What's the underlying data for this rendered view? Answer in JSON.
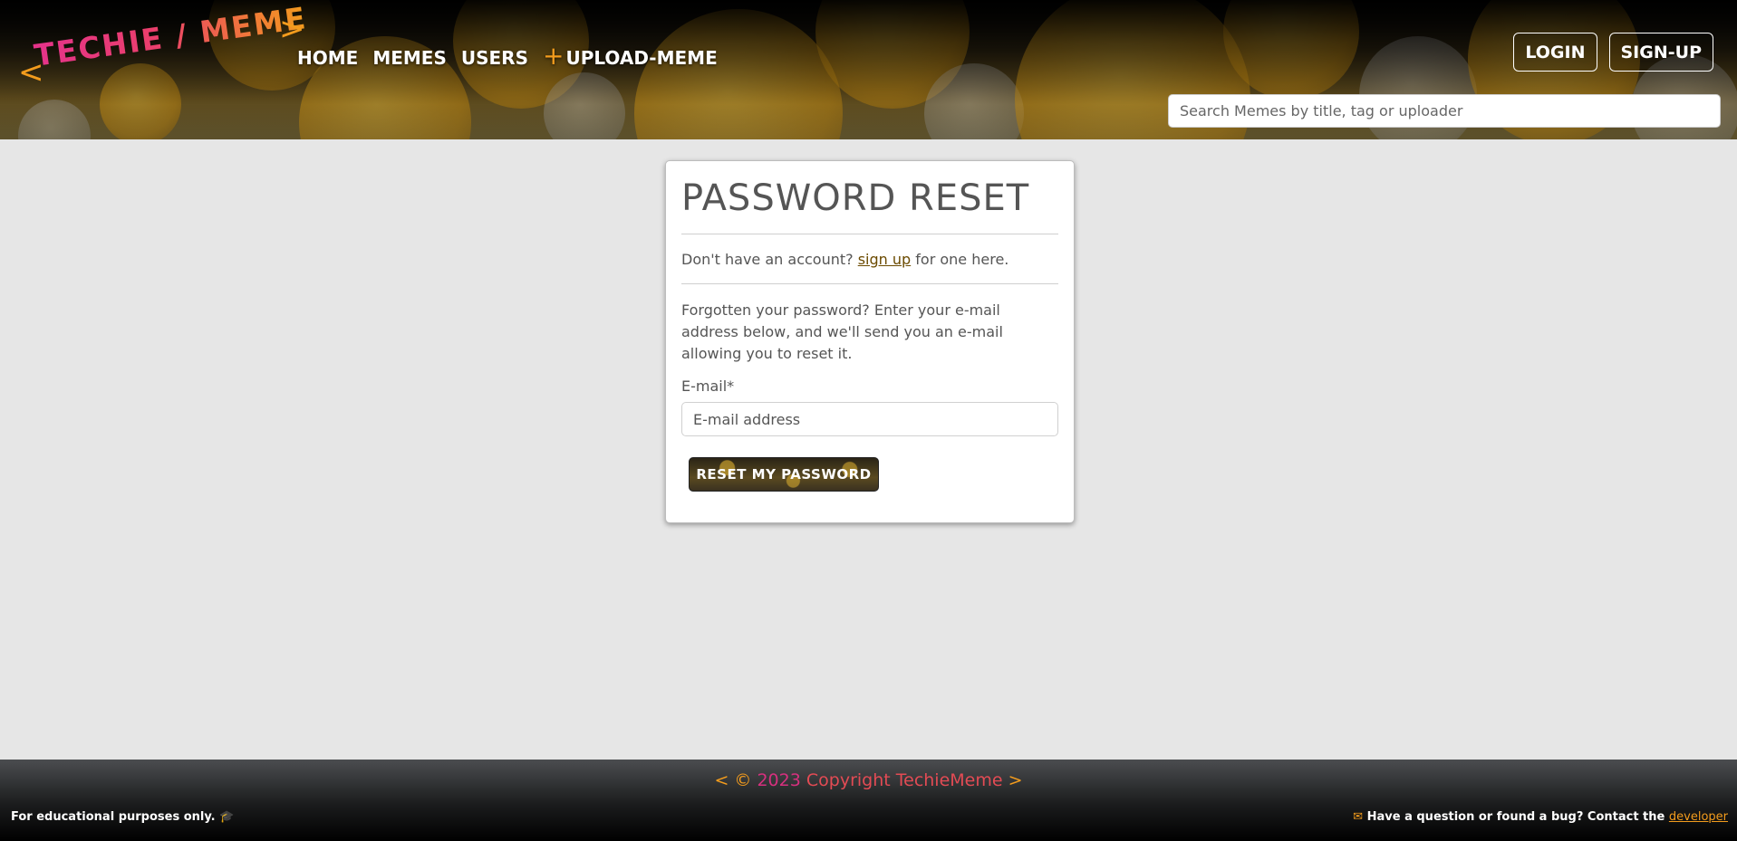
{
  "header": {
    "brand": {
      "open": "<",
      "text": "TECHIE / MEME",
      "close": ">"
    },
    "nav": [
      {
        "label": "HOME"
      },
      {
        "label": "MEMES"
      },
      {
        "label": "USERS"
      },
      {
        "label": "UPLOAD-MEME",
        "prefix": "+"
      }
    ],
    "auth": {
      "login": "LOGIN",
      "signup": "SIGN-UP"
    },
    "search": {
      "placeholder": "Search Memes by title, tag or uploader"
    }
  },
  "card": {
    "title": "PASSWORD RESET",
    "signup_prefix": "Don't have an account?",
    "signup_link": "sign up",
    "signup_suffix": "for one here.",
    "instructions": "Forgotten your password? Enter your e-mail address below, and we'll send you an e-mail allowing you to reset it.",
    "email_label": "E-mail*",
    "email_placeholder": "E-mail address",
    "submit": "RESET MY PASSWORD"
  },
  "footer": {
    "chev_left": "<",
    "copyright_symbol": "©",
    "year": "2023",
    "copyright_text": "Copyright TechieMeme",
    "chev_right": ">",
    "edu_text": "For educational purposes only.",
    "edu_icon": "graduation-cap-icon",
    "contact_text": "Have a question or found a bug? Contact the",
    "contact_link": "developer",
    "contact_icon": "envelope-icon"
  },
  "colors": {
    "accent_orange": "#f39c1d",
    "accent_pink": "#e5338a",
    "page_bg": "#e6e6e6"
  }
}
